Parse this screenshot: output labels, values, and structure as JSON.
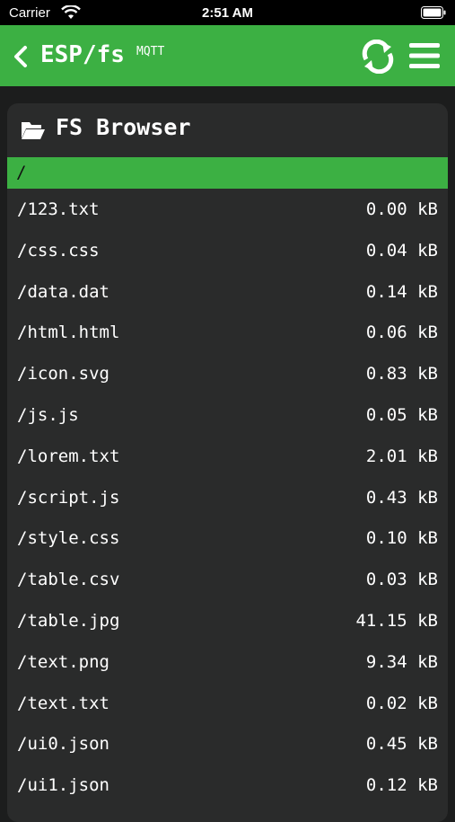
{
  "status_bar": {
    "carrier": "Carrier",
    "time": "2:51 AM"
  },
  "header": {
    "title": "ESP/fs",
    "subtitle": "MQTT",
    "accent_color": "#3cb043",
    "icons": [
      "back-chevron-icon",
      "refresh-icon",
      "menu-icon"
    ]
  },
  "browser": {
    "title": "FS Browser",
    "current_path": "/",
    "files": [
      {
        "name": "/123.txt",
        "size": "0.00 kB"
      },
      {
        "name": "/css.css",
        "size": "0.04 kB"
      },
      {
        "name": "/data.dat",
        "size": "0.14 kB"
      },
      {
        "name": "/html.html",
        "size": "0.06 kB"
      },
      {
        "name": "/icon.svg",
        "size": "0.83 kB"
      },
      {
        "name": "/js.js",
        "size": "0.05 kB"
      },
      {
        "name": "/lorem.txt",
        "size": "2.01 kB"
      },
      {
        "name": "/script.js",
        "size": "0.43 kB"
      },
      {
        "name": "/style.css",
        "size": "0.10 kB"
      },
      {
        "name": "/table.csv",
        "size": "0.03 kB"
      },
      {
        "name": "/table.jpg",
        "size": "41.15 kB"
      },
      {
        "name": "/text.png",
        "size": "9.34 kB"
      },
      {
        "name": "/text.txt",
        "size": "0.02 kB"
      },
      {
        "name": "/ui0.json",
        "size": "0.45 kB"
      },
      {
        "name": "/ui1.json",
        "size": "0.12 kB"
      }
    ]
  }
}
